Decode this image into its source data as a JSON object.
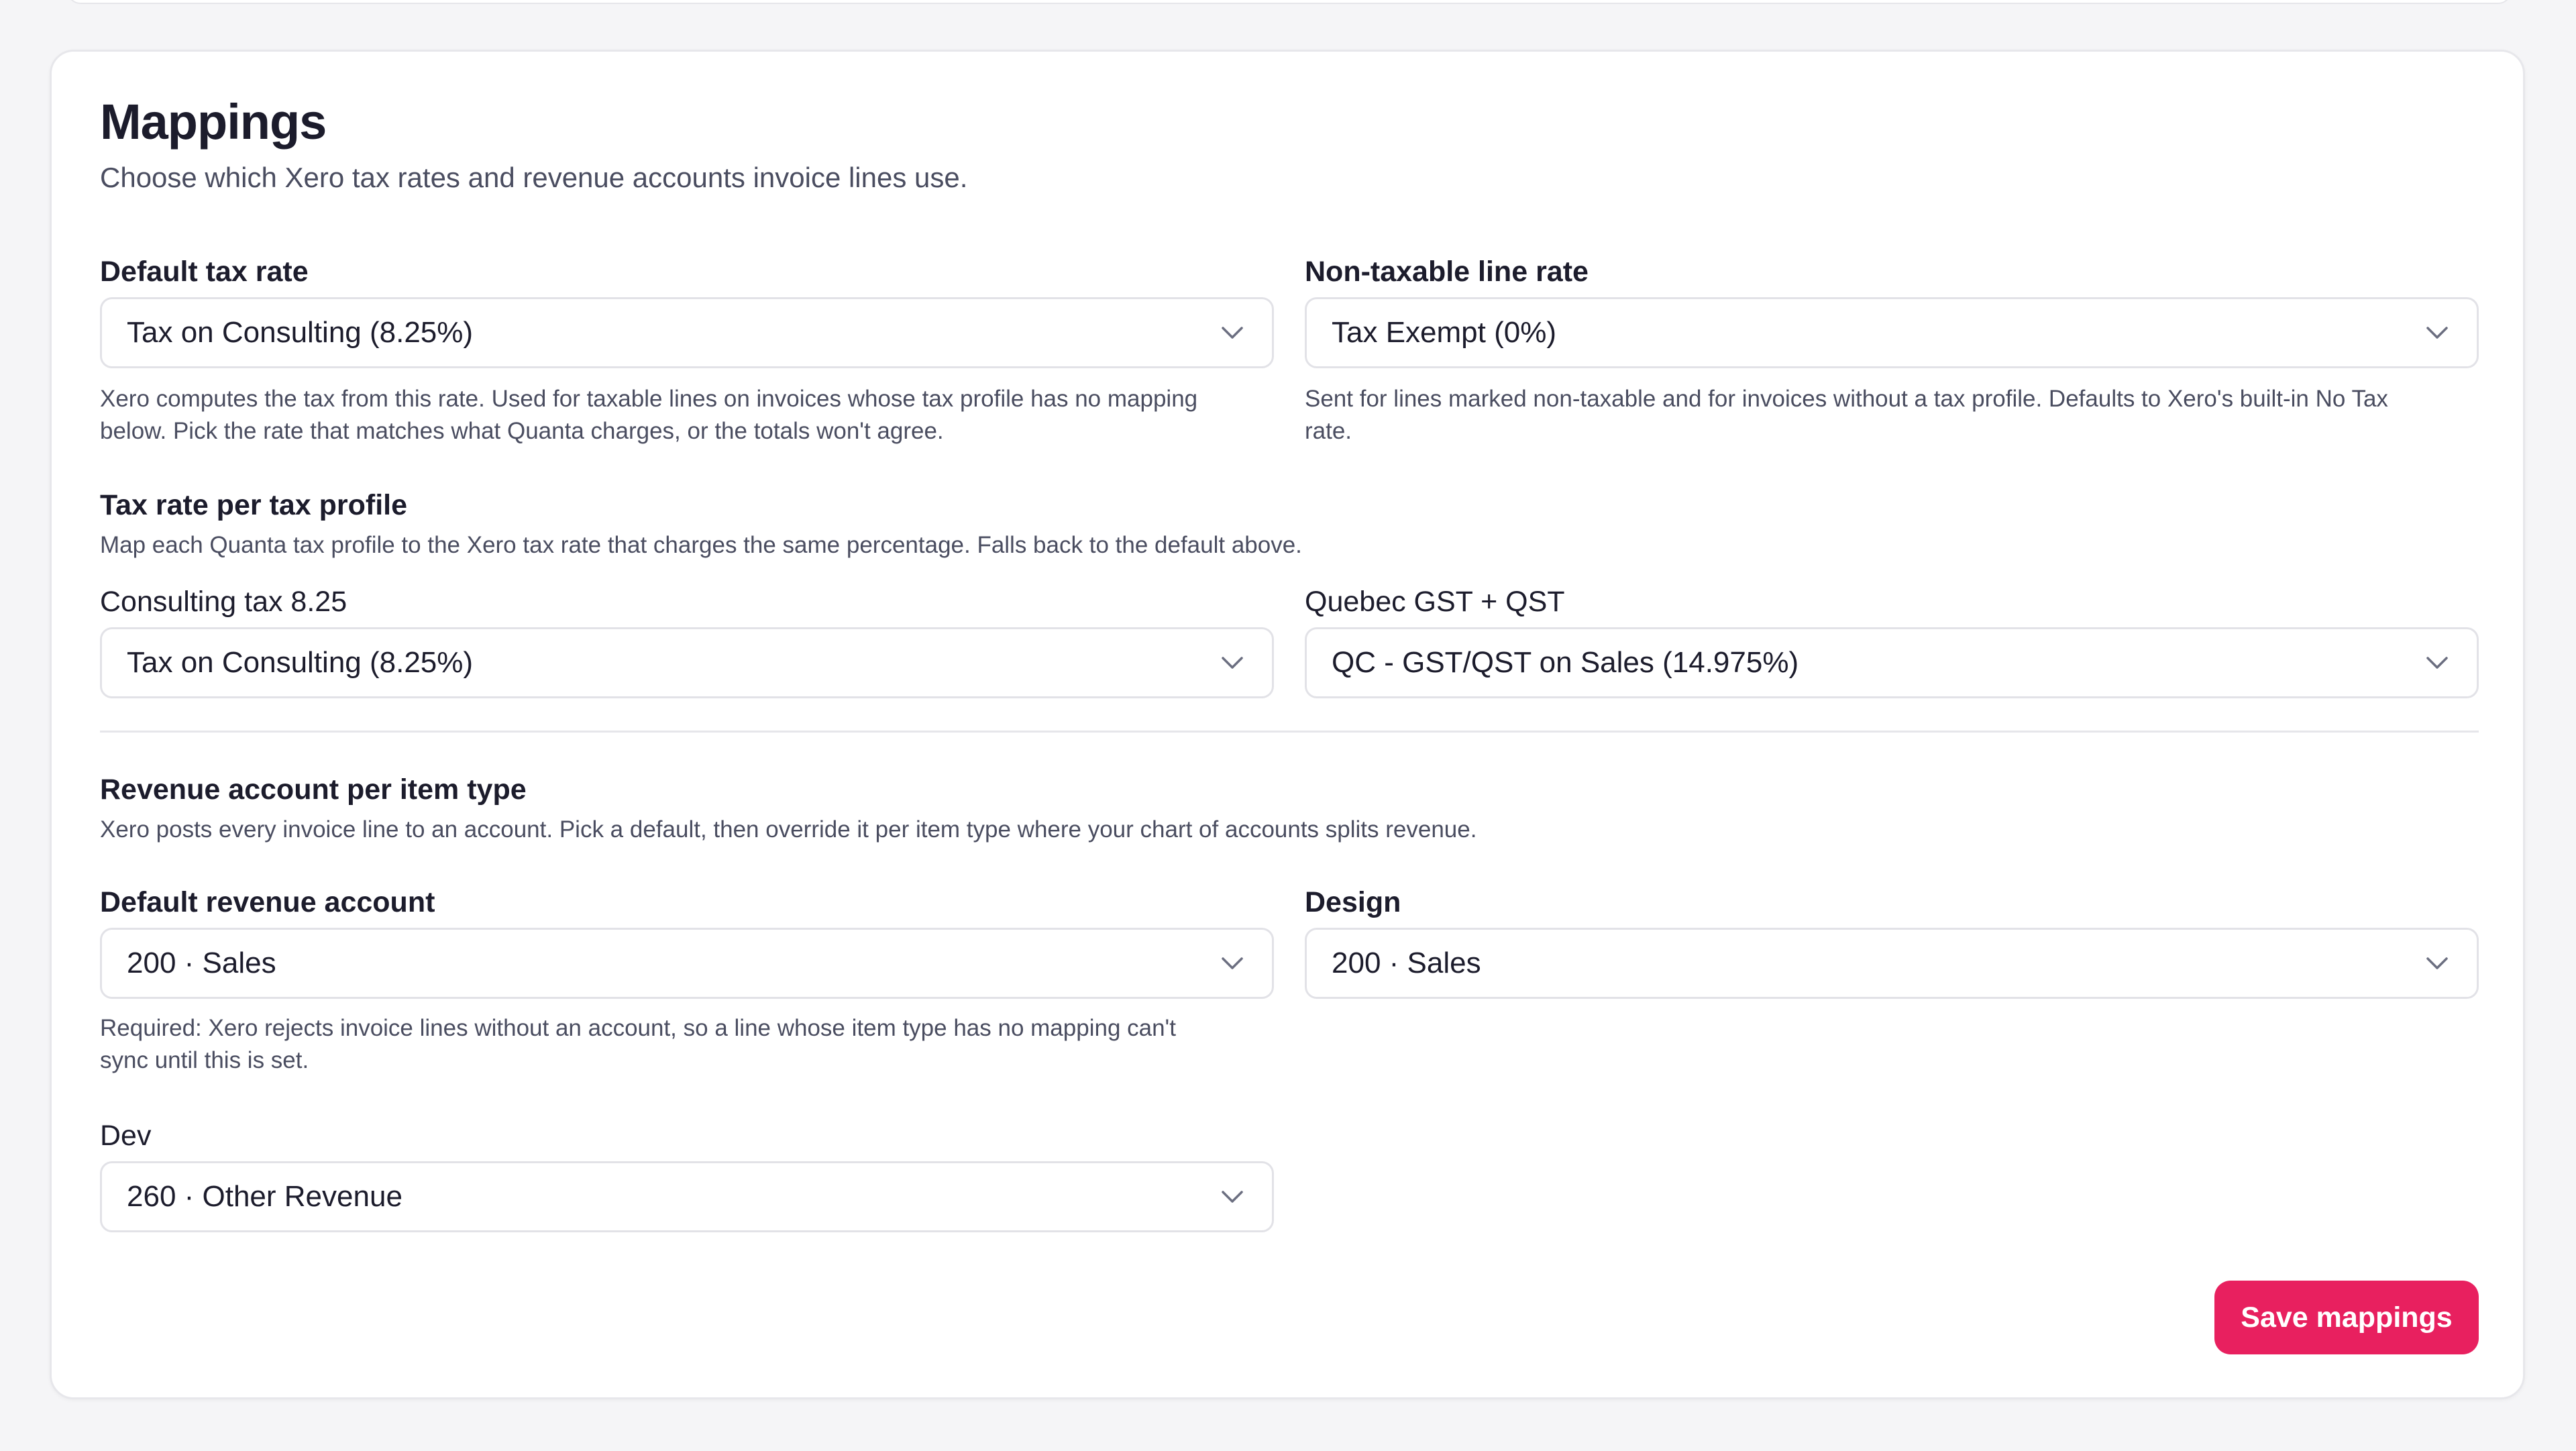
{
  "section": {
    "title": "Mappings",
    "subtitle": "Choose which Xero tax rates and revenue accounts invoice lines use."
  },
  "default_tax": {
    "label": "Default tax rate",
    "value": "Tax on Consulting (8.25%)",
    "help_line1": "Xero computes the tax from this rate. Used for taxable lines on invoices whose tax profile has no mapping",
    "help_line2": "below. Pick the rate that matches what Quanta charges, or the totals won't agree."
  },
  "nontaxable": {
    "label": "Non-taxable line rate",
    "value": "Tax Exempt (0%)",
    "help_line1": "Sent for lines marked non-taxable and for invoices without a tax profile. Defaults to Xero's built-in No Tax",
    "help_line2": "rate."
  },
  "tax_profiles": {
    "heading": "Tax rate per tax profile",
    "description": "Map each Quanta tax profile to the Xero tax rate that charges the same percentage. Falls back to the default above.",
    "items": [
      {
        "label": "Consulting tax 8.25",
        "value": "Tax on Consulting (8.25%)"
      },
      {
        "label": "Quebec GST + QST",
        "value": "QC - GST/QST on Sales (14.975%)"
      }
    ]
  },
  "revenue": {
    "heading": "Revenue account per item type",
    "description": "Xero posts every invoice line to an account. Pick a default, then override it per item type where your chart of accounts splits revenue.",
    "default": {
      "label": "Default revenue account",
      "value": "200 · Sales",
      "help_line1": "Required: Xero rejects invoice lines without an account, so a line whose item type has no mapping can't",
      "help_line2": "sync until this is set."
    },
    "items": [
      {
        "label": "Design",
        "value": "200 · Sales"
      },
      {
        "label": "Dev",
        "value": "260 · Other Revenue"
      }
    ]
  },
  "actions": {
    "save_label": "Save mappings"
  },
  "colors": {
    "accent": "#e8205f",
    "border": "#e2e2e7",
    "muted_text": "#4a4d60",
    "background": "#f5f5f7"
  }
}
